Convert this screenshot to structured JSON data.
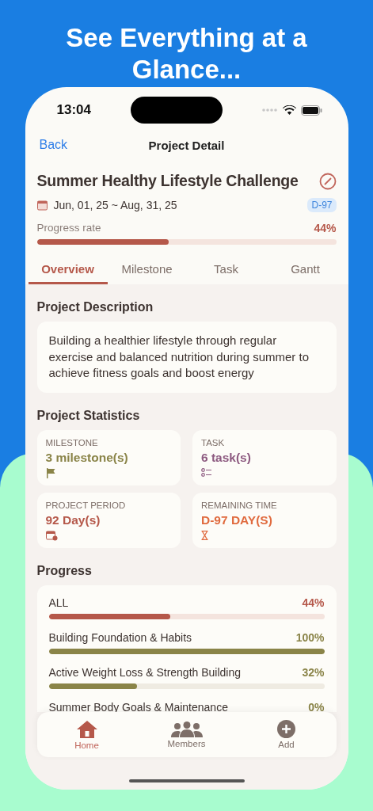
{
  "headline": "See Everything at a Glance...",
  "status_bar": {
    "time": "13:04"
  },
  "nav": {
    "back": "Back",
    "title": "Project Detail"
  },
  "project": {
    "title": "Summer Healthy Lifestyle Challenge",
    "dates": "Jun, 01, 25 ~ Aug, 31, 25",
    "badge": "D-97",
    "progress_label": "Progress rate",
    "progress_value": "44%",
    "level": 0.44
  },
  "tabs": [
    {
      "label": "Overview",
      "selected": true
    },
    {
      "label": "Milestone",
      "selected": false
    },
    {
      "label": "Task",
      "selected": false
    },
    {
      "label": "Gantt",
      "selected": false
    }
  ],
  "description": {
    "heading": "Project Description",
    "text": "Building a healthier lifestyle through regular exercise and balanced nutrition during summer to achieve fitness goals and boost energy"
  },
  "statistics": {
    "heading": "Project Statistics",
    "cards": [
      {
        "kind": "milestone",
        "label": "MILESTONE",
        "value": "3 milestone(s)",
        "color": "#8a8448"
      },
      {
        "kind": "task",
        "label": "TASK",
        "value": "6 task(s)",
        "color": "#8d5a80"
      },
      {
        "kind": "period",
        "label": "PROJECT PERIOD",
        "value": "92 Day(s)",
        "color": "#b5584a"
      },
      {
        "kind": "remaining",
        "label": "REMAINING TIME",
        "value": "D-97 DAY(S)",
        "color": "#e06a3e"
      }
    ]
  },
  "progress": {
    "heading": "Progress",
    "items": [
      {
        "label": "ALL",
        "value": "44%",
        "level": 0.44,
        "color": "#b5584a"
      },
      {
        "label": "Building Foundation & Habits",
        "value": "100%",
        "level": 1,
        "color": "#8a8448"
      },
      {
        "label": "Active Weight Loss & Strength Building",
        "value": "32%",
        "level": 0.32,
        "color": "#8a8448"
      },
      {
        "label": "Summer Body Goals & Maintenance",
        "value": "0%",
        "color": "#8a8448"
      }
    ]
  },
  "tab_bar": [
    {
      "kind": "home",
      "label": "Home",
      "selected": true
    },
    {
      "kind": "members",
      "label": "Members",
      "selected": false
    },
    {
      "kind": "add",
      "label": "Add",
      "selected": false
    }
  ]
}
